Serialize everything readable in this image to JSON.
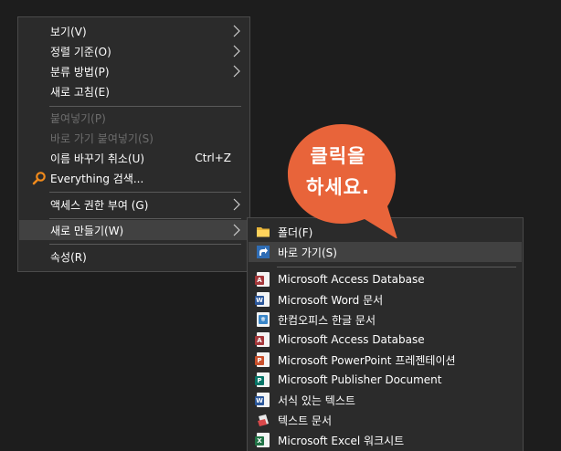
{
  "main_menu": {
    "items": [
      {
        "label": "보기(V)"
      },
      {
        "label": "정렬 기준(O)"
      },
      {
        "label": "분류 방법(P)"
      },
      {
        "label": "새로 고침(E)"
      },
      {
        "label": "붙여넣기(P)"
      },
      {
        "label": "바로 가기 붙여넣기(S)"
      },
      {
        "label": "이름 바꾸기 취소(U)",
        "shortcut": "Ctrl+Z"
      },
      {
        "label": "Everything 검색..."
      },
      {
        "label": "액세스 권한 부여 (G)"
      },
      {
        "label": "새로 만들기(W)"
      },
      {
        "label": "속성(R)"
      }
    ]
  },
  "sub_menu": {
    "items": [
      {
        "label": "폴더(F)"
      },
      {
        "label": "바로 가기(S)"
      },
      {
        "label": "Microsoft Access Database"
      },
      {
        "label": "Microsoft Word 문서"
      },
      {
        "label": "한컴오피스 한글 문서"
      },
      {
        "label": "Microsoft Access Database"
      },
      {
        "label": "Microsoft PowerPoint 프레젠테이션"
      },
      {
        "label": "Microsoft Publisher Document"
      },
      {
        "label": "서식 있는 텍스트"
      },
      {
        "label": "텍스트 문서"
      },
      {
        "label": "Microsoft Excel 워크시트"
      }
    ]
  },
  "callout": {
    "line1": "클릭을",
    "line2": "하세요."
  },
  "colors": {
    "menu_bg": "#2b2b2b",
    "hover_bg": "#414141",
    "disabled_text": "#6d6d6d",
    "callout": "#e8643a"
  },
  "icons": {
    "everything": "magnifier-icon",
    "folder": "folder-icon",
    "shortcut": "shortcut-icon",
    "access": "access-icon",
    "word": "word-icon",
    "hwp": "hwp-icon",
    "powerpoint": "powerpoint-icon",
    "publisher": "publisher-icon",
    "rtf": "rtf-icon",
    "text": "text-doc-icon",
    "excel": "excel-icon"
  }
}
